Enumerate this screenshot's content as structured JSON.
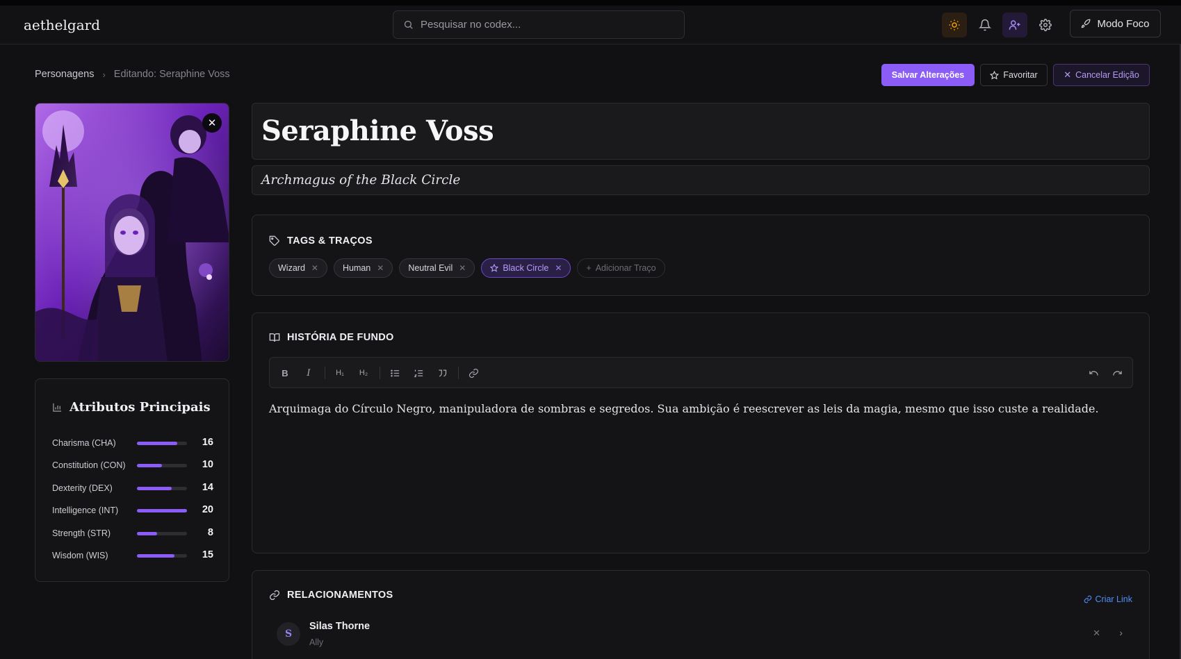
{
  "app": {
    "brand": "aethelgard"
  },
  "search": {
    "placeholder": "Pesquisar no codex..."
  },
  "topbar": {
    "focus_label": "Modo Foco"
  },
  "breadcrumb": {
    "home": "Personagens",
    "current": "Editando: Seraphine Voss"
  },
  "actions": {
    "save": "Salvar Alterações",
    "favorite": "Favoritar",
    "cancel": "Cancelar Edição"
  },
  "character": {
    "name": "Seraphine Voss",
    "subtitle": "Archmagus of the Black Circle"
  },
  "attributes": {
    "title": "Atributos Principais",
    "items": [
      {
        "label": "Charisma (CHA)",
        "value": "16",
        "fill": 0.8
      },
      {
        "label": "Constitution (CON)",
        "value": "10",
        "fill": 0.5
      },
      {
        "label": "Dexterity (DEX)",
        "value": "14",
        "fill": 0.7
      },
      {
        "label": "Intelligence (INT)",
        "value": "20",
        "fill": 1.0
      },
      {
        "label": "Strength (STR)",
        "value": "8",
        "fill": 0.4
      },
      {
        "label": "Wisdom (WIS)",
        "value": "15",
        "fill": 0.75
      }
    ]
  },
  "tags": {
    "title": "TAGS & TRAÇOS",
    "items": [
      "Wizard",
      "Human",
      "Neutral Evil",
      "Black Circle"
    ],
    "add_label": "Adicionar Traço"
  },
  "story": {
    "title": "HISTÓRIA DE FUNDO",
    "text": "Arquimaga do Círculo Negro, manipuladora de sombras e segredos. Sua ambição é reescrever as leis da magia, mesmo que isso custe a realidade."
  },
  "relations": {
    "title": "RELACIONAMENTOS",
    "create_label": "Criar Link",
    "items": [
      {
        "initial": "S",
        "name": "Silas Thorne",
        "role": "Ally"
      }
    ]
  },
  "colors": {
    "accent": "#8b5cf6",
    "link": "#4f8ff7",
    "background": "#111113",
    "sun_highlight": "#f59e0b"
  }
}
